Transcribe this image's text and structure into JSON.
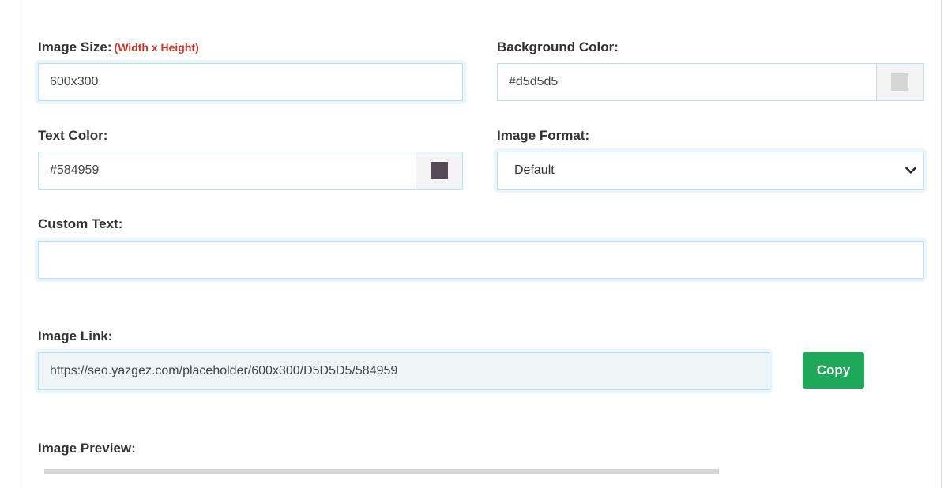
{
  "form": {
    "image_size": {
      "label": "Image Size:",
      "hint": "(Width x Height)",
      "value": "600x300"
    },
    "background_color": {
      "label": "Background Color:",
      "value": "#d5d5d5",
      "swatch_color": "#d5d5d5"
    },
    "text_color": {
      "label": "Text Color:",
      "value": "#584959",
      "swatch_color": "#584959"
    },
    "image_format": {
      "label": "Image Format:",
      "selected": "Default"
    },
    "custom_text": {
      "label": "Custom Text:",
      "value": ""
    },
    "image_link": {
      "label": "Image Link:",
      "value": "https://seo.yazgez.com/placeholder/600x300/D5D5D5/584959"
    },
    "copy_button": {
      "label": "Copy"
    },
    "image_preview": {
      "label": "Image Preview:"
    }
  },
  "colors": {
    "accent_green": "#1ea85a",
    "field_border": "#b8dff2",
    "hint_red": "#c0392b"
  },
  "icons": {
    "select_arrow": "chevron-down-icon"
  }
}
